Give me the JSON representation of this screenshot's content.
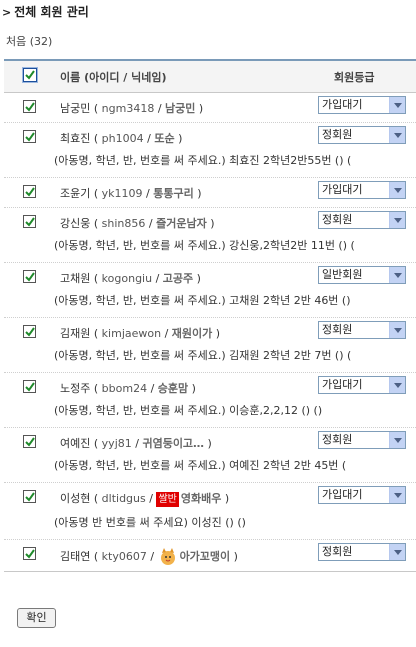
{
  "header": {
    "title": "전체 회원 관리",
    "count_text": "처음 (32)"
  },
  "table": {
    "col_name": "이름 (아이디 / 닉네임)",
    "col_grade": "회원등급"
  },
  "rows": [
    {
      "name": "남궁민",
      "id": "ngm3418",
      "nick": "남궁민",
      "grade": "가입대기",
      "note": ""
    },
    {
      "name": "최효진",
      "id": "ph1004",
      "nick": "또순",
      "grade": "정회원",
      "note": "(아동명, 학년, 반, 번호를 써 주세요.) 최효진 2학년2반55번   ()  ("
    },
    {
      "name": "조윤기",
      "id": "yk1109",
      "nick": "통통구리",
      "grade": "가입대기",
      "note": ""
    },
    {
      "name": "강신웅",
      "id": "shin856",
      "nick": "즐거운남자",
      "grade": "정회원",
      "note": "(아동명, 학년, 반, 번호를 써 주세요.) 강신웅,2학년2반 11번   ()   ("
    },
    {
      "name": "고채원",
      "id": "kogongiu",
      "nick": "고공주",
      "grade": "일반회원",
      "note": "(아동명, 학년, 반, 번호를 써 주세요.) 고채원 2학년 2반 46번   ()"
    },
    {
      "name": "김재원",
      "id": "kimjaewon",
      "nick": "재원이가",
      "grade": "정회원",
      "note": "(아동명, 학년, 반, 번호를 써 주세요.) 김재원 2학년 2반 7번   ()   ("
    },
    {
      "name": "노정주",
      "id": "bbom24",
      "nick": "승훈맘",
      "grade": "가입대기",
      "note": "(아동명, 학년, 반, 번호를 써 주세요.) 이승훈,2,2,12   ()   ()"
    },
    {
      "name": "여예진",
      "id": "yyj81",
      "nick": "귀염둥이고…",
      "grade": "정회원",
      "note": "(아동명, 학년, 반, 번호를 써 주세요.) 여예진 2학년 2반 45번   ("
    },
    {
      "name": "이성현",
      "id": "dltidgus",
      "nick": "영화배우",
      "badge": "쌀반",
      "grade": "가입대기",
      "note": "(아동명 반 번호를 써 주세요) 이성진   ()   ()"
    },
    {
      "name": "김태연",
      "id": "kty0607",
      "nick": "아가꼬맹이",
      "grade": "정회원",
      "note": ""
    }
  ],
  "footer": {
    "confirm_label": "확인"
  },
  "colors": {
    "accent_border": "#7a9ab8",
    "select_arrow_bg": "#c3d3f4",
    "badge_red": "#e00000",
    "check_green": "#1f8a2a"
  }
}
